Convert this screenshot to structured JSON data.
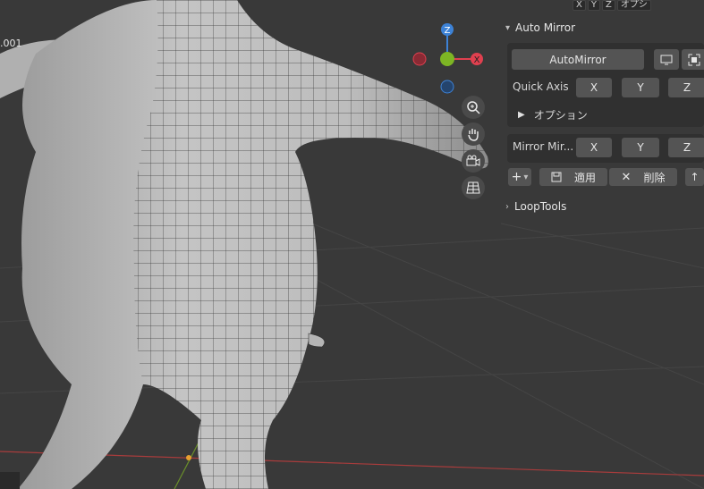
{
  "viewport": {
    "object_label": ".001",
    "top_axis_labels": [
      "X",
      "Y",
      "Z"
    ],
    "top_right_label": "オプシ",
    "gizmo": {
      "z_label": "Z",
      "x_label": "X",
      "colors": {
        "x": "#e0404f",
        "y": "#7db524",
        "z": "#3d82d6"
      }
    },
    "nav_icons": [
      "zoom-icon",
      "hand-icon",
      "camera-icon",
      "grid-icon"
    ]
  },
  "auto_mirror": {
    "title": "Auto Mirror",
    "automirror_button": "AutoMirror",
    "quick_axis_label": "Quick Axis",
    "axis_buttons": [
      "X",
      "Y",
      "Z"
    ],
    "options_label": "オプション",
    "mirror_label": "Mirror Mir...",
    "mirror_axis_buttons": [
      "X",
      "Y",
      "Z"
    ],
    "add_symbol": "+",
    "apply_label": "適用",
    "delete_label": "削除"
  },
  "loop_tools": {
    "title": "LoopTools"
  }
}
